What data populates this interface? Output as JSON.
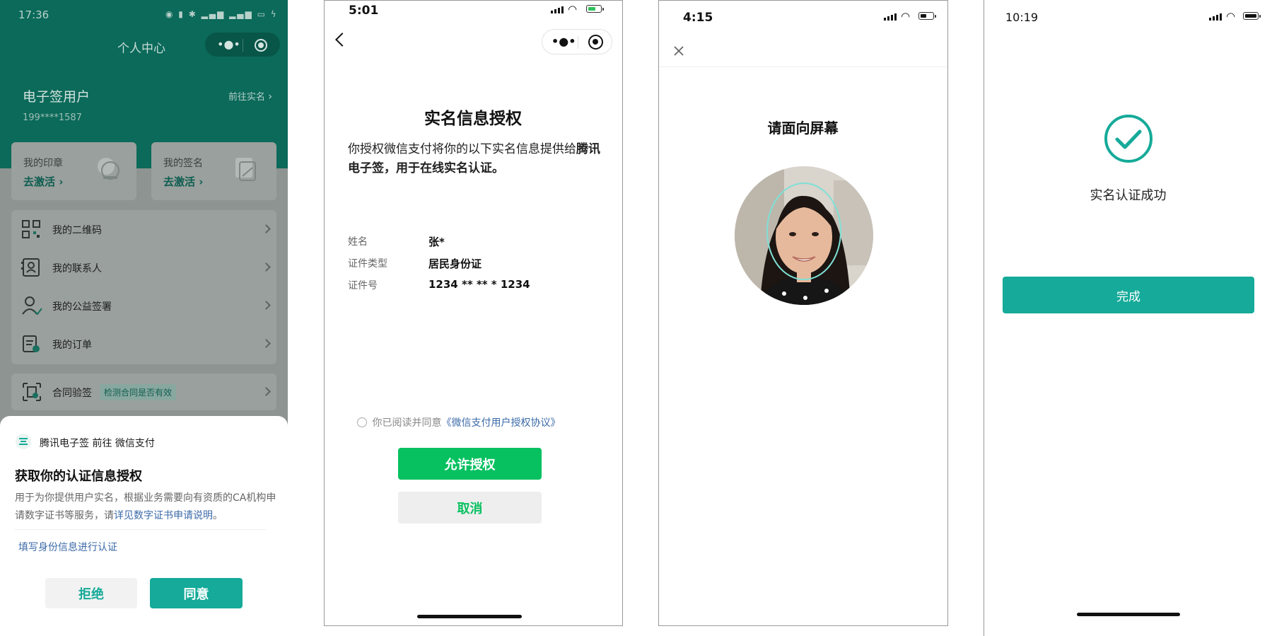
{
  "screen1": {
    "status_time": "17:36",
    "nav_title": "个人中心",
    "user_name": "电子签用户",
    "go_verify": "前往实名",
    "phone": "199****1587",
    "card_seal": {
      "title": "我的印章",
      "action": "去激活"
    },
    "card_sign": {
      "title": "我的签名",
      "action": "去激活"
    },
    "menu": [
      "我的二维码",
      "我的联系人",
      "我的公益签署",
      "我的订单"
    ],
    "contract_check": {
      "label": "合同验签",
      "tag": "检测合同是否有效"
    },
    "sheet": {
      "app_line": "腾讯电子签 前往 微信支付",
      "title": "获取你的认证信息授权",
      "desc_prefix": "用于为你提供用户实名，根据业务需要向有资质的CA机构申请数字证书等服务，请",
      "desc_link": "详见数字证书申请说明",
      "desc_suffix": "。",
      "manual_link": "填写身份信息进行认证",
      "reject": "拒绝",
      "agree": "同意"
    }
  },
  "screen2": {
    "status_time": "5:01",
    "title": "实名信息授权",
    "desc_prefix": "你授权微信支付将你的以下实名信息提供给",
    "desc_bold": "腾讯电子签，用于在线实名认证。",
    "fields": [
      {
        "label": "姓名",
        "value": "张*"
      },
      {
        "label": "证件类型",
        "value": "居民身份证"
      },
      {
        "label": "证件号",
        "value": "1234 ** ** * 1234"
      }
    ],
    "agree_prefix": "你已阅读并同意",
    "agree_link": "《微信支付用户授权协议》",
    "allow": "允许授权",
    "cancel": "取消"
  },
  "screen3": {
    "status_time": "4:15",
    "prompt": "请面向屏幕"
  },
  "screen4": {
    "status_time": "10:19",
    "success_text": "实名认证成功",
    "done": "完成"
  },
  "colors": {
    "brand_green": "#0b6a5a",
    "teal_button": "#15aa99",
    "wechat_green": "#07c160",
    "link_blue": "#3c6aa8"
  },
  "icons": [
    "qrcode-icon",
    "contacts-icon",
    "charity-sign-icon",
    "order-icon",
    "contract-check-icon",
    "seal-icon",
    "signature-icon",
    "back-icon",
    "close-icon",
    "check-icon"
  ]
}
